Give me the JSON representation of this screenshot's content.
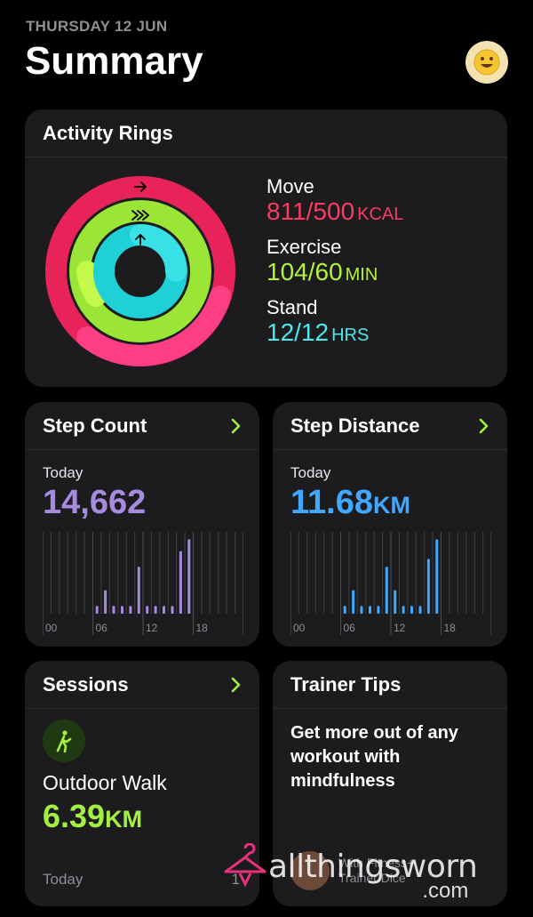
{
  "header": {
    "date": "THURSDAY 12 JUN",
    "title": "Summary",
    "avatar_icon": "smiley-icon"
  },
  "activity": {
    "title": "Activity Rings",
    "move": {
      "label": "Move",
      "value": "811/500",
      "unit": "KCAL",
      "color": "#fa114f",
      "progress": 1.62
    },
    "exercise": {
      "label": "Exercise",
      "value": "104/60",
      "unit": "MIN",
      "color": "#a4f042",
      "progress": 1.73
    },
    "stand": {
      "label": "Stand",
      "value": "12/12",
      "unit": "HRS",
      "color": "#00f0ea",
      "progress": 1.0
    }
  },
  "steps": {
    "title": "Step Count",
    "sub": "Today",
    "value": "14,662",
    "color": "#a78be0",
    "ticks": [
      "00",
      "06",
      "12",
      "18"
    ]
  },
  "distance": {
    "title": "Step Distance",
    "sub": "Today",
    "value": "11.68",
    "unit": "KM",
    "color": "#40a9ff",
    "ticks": [
      "00",
      "06",
      "12",
      "18"
    ]
  },
  "sessions": {
    "title": "Sessions",
    "icon": "walking-icon",
    "name": "Outdoor Walk",
    "value": "6.39",
    "unit": "KM",
    "footer_left": "Today",
    "footer_right": "1"
  },
  "tips": {
    "title": "Trainer Tips",
    "text": "Get more out of any workout with mindfulness",
    "source_line1": "With Fitness+",
    "source_line2": "Trainer Dice"
  },
  "chart_data": [
    {
      "type": "bar",
      "title": "Step Count",
      "categories": [
        "0",
        "1",
        "2",
        "3",
        "4",
        "5",
        "6",
        "7",
        "8",
        "9",
        "10",
        "11",
        "12",
        "13",
        "14",
        "15",
        "16",
        "17",
        "18",
        "19",
        "20",
        "21",
        "22",
        "23"
      ],
      "values": [
        0,
        0,
        0,
        0,
        0,
        0,
        0.1,
        0.3,
        0.1,
        0.1,
        0.1,
        0.6,
        0.1,
        0.1,
        0.1,
        0.1,
        0.8,
        0.95,
        0,
        0,
        0,
        0,
        0,
        0
      ]
    },
    {
      "type": "bar",
      "title": "Step Distance",
      "categories": [
        "0",
        "1",
        "2",
        "3",
        "4",
        "5",
        "6",
        "7",
        "8",
        "9",
        "10",
        "11",
        "12",
        "13",
        "14",
        "15",
        "16",
        "17",
        "18",
        "19",
        "20",
        "21",
        "22",
        "23"
      ],
      "values": [
        0,
        0,
        0,
        0,
        0,
        0,
        0.1,
        0.3,
        0.1,
        0.1,
        0.1,
        0.6,
        0.3,
        0.1,
        0.1,
        0.1,
        0.7,
        0.95,
        0,
        0,
        0,
        0,
        0,
        0
      ]
    }
  ],
  "watermark": {
    "text": "allthingsworn",
    "domain": ".com"
  }
}
